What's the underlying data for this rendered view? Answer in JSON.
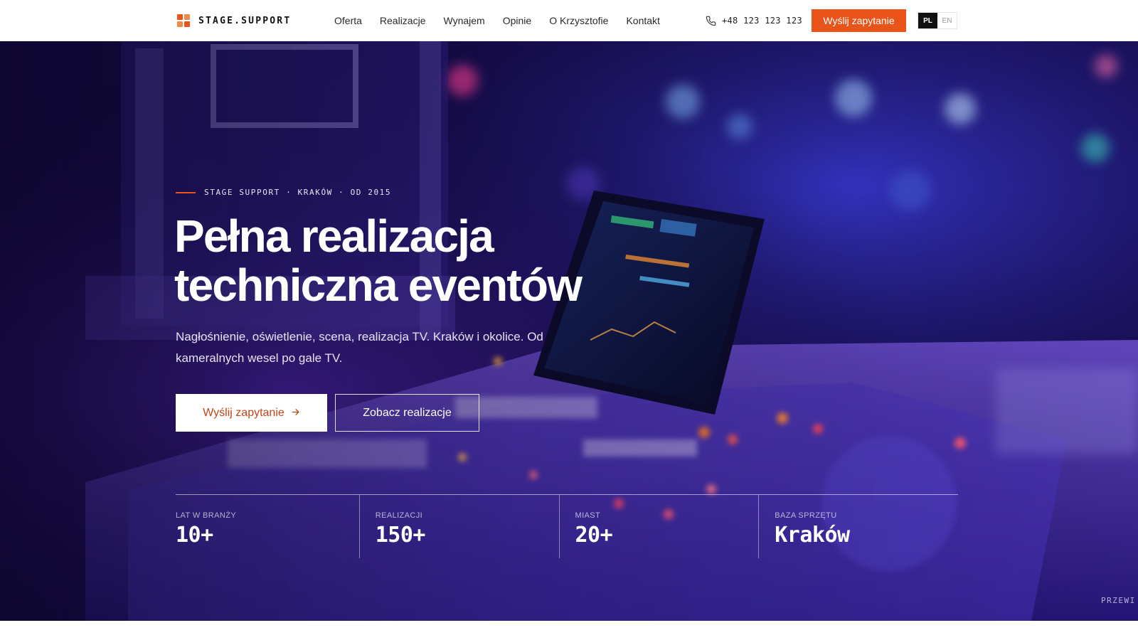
{
  "brand": {
    "name": "STAGE.SUPPORT",
    "logo_colors": [
      "#e8541a",
      "#f08a4b",
      "#f08a4b",
      "#e8541a"
    ]
  },
  "nav": {
    "items": [
      {
        "label": "Oferta"
      },
      {
        "label": "Realizacje"
      },
      {
        "label": "Wynajem"
      },
      {
        "label": "Opinie"
      },
      {
        "label": "O Krzysztofie"
      },
      {
        "label": "Kontakt"
      }
    ]
  },
  "header": {
    "phone": "+48 123 123 123",
    "phone_icon": "phone-icon",
    "cta_label": "Wyślij zapytanie",
    "languages": [
      {
        "code": "PL",
        "active": true
      },
      {
        "code": "EN",
        "active": false
      }
    ]
  },
  "hero": {
    "eyebrow": "STAGE SUPPORT · KRAKÓW · OD 2015",
    "headline_line1": "Pełna realizacja",
    "headline_line2": "techniczna eventów",
    "subtitle": "Nagłośnienie, oświetlenie, scena, realizacja TV. Kraków i okolice. Od kameralnych wesel po gale TV.",
    "primary_cta": "Wyślij zapytanie",
    "primary_cta_icon": "arrow-right-icon",
    "secondary_cta": "Zobacz realizacje",
    "scroll_hint": "PRZEWI"
  },
  "stats": [
    {
      "label": "LAT W BRANŻY",
      "value": "10+"
    },
    {
      "label": "REALIZACJI",
      "value": "150+"
    },
    {
      "label": "MIAST",
      "value": "20+"
    },
    {
      "label": "BAZA SPRZĘTU",
      "value": "Kraków"
    }
  ],
  "colors": {
    "accent": "#e8541a",
    "dark": "#111111",
    "hero_base": "#12083a"
  }
}
